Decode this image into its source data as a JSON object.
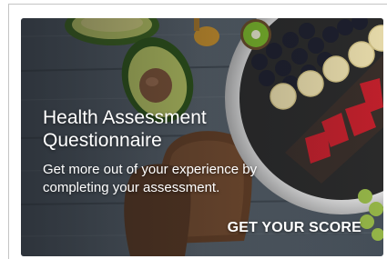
{
  "card": {
    "title": "Health Assessment Questionnaire",
    "description": "Get more out of your experience by completing your assessment.",
    "cta_label": "GET YOUR SCORE",
    "background_image": "healthy-food-on-wooden-table",
    "text_color": "#ffffff"
  }
}
